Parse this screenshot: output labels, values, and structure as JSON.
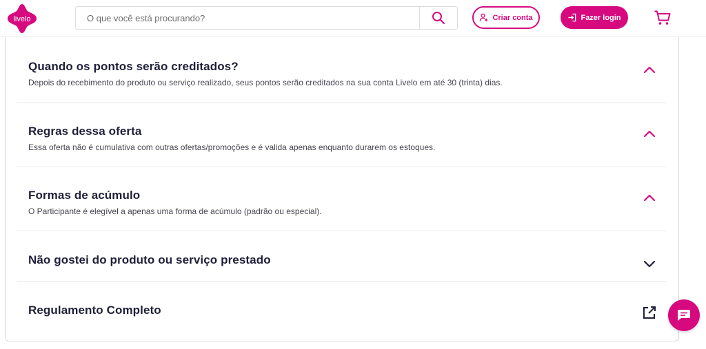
{
  "brand": {
    "logo_text": "livelo",
    "accent": "#d6097f",
    "heading_color": "#1f1f3a"
  },
  "header": {
    "search": {
      "placeholder": "O que você está procurando?",
      "value": "",
      "icon": "search-icon"
    },
    "create_account": {
      "label": "Criar conta",
      "icon": "add-user-icon"
    },
    "login": {
      "label": "Fazer login",
      "icon": "login-icon"
    },
    "cart": {
      "icon": "cart-icon"
    }
  },
  "faq": [
    {
      "title": "Quando os pontos serão creditados?",
      "text": "Depois do recebimento do produto ou serviço realizado, seus pontos serão creditados na sua conta Livelo em até 30 (trinta) dias.",
      "state": "expanded"
    },
    {
      "title": "Regras dessa oferta",
      "text": "Essa oferta não é cumulativa com outras ofertas/promoções e é valida apenas enquanto durarem os estoques.",
      "state": "expanded"
    },
    {
      "title": "Formas de acúmulo",
      "text": "O Participante é elegível a apenas uma forma de acúmulo (padrão ou especial).",
      "state": "expanded"
    },
    {
      "title": "Não gostei do produto ou serviço prestado",
      "state": "collapsed"
    },
    {
      "title": "Regulamento Completo",
      "icon": "external-link-icon"
    }
  ],
  "chat": {
    "icon": "chat-icon"
  }
}
